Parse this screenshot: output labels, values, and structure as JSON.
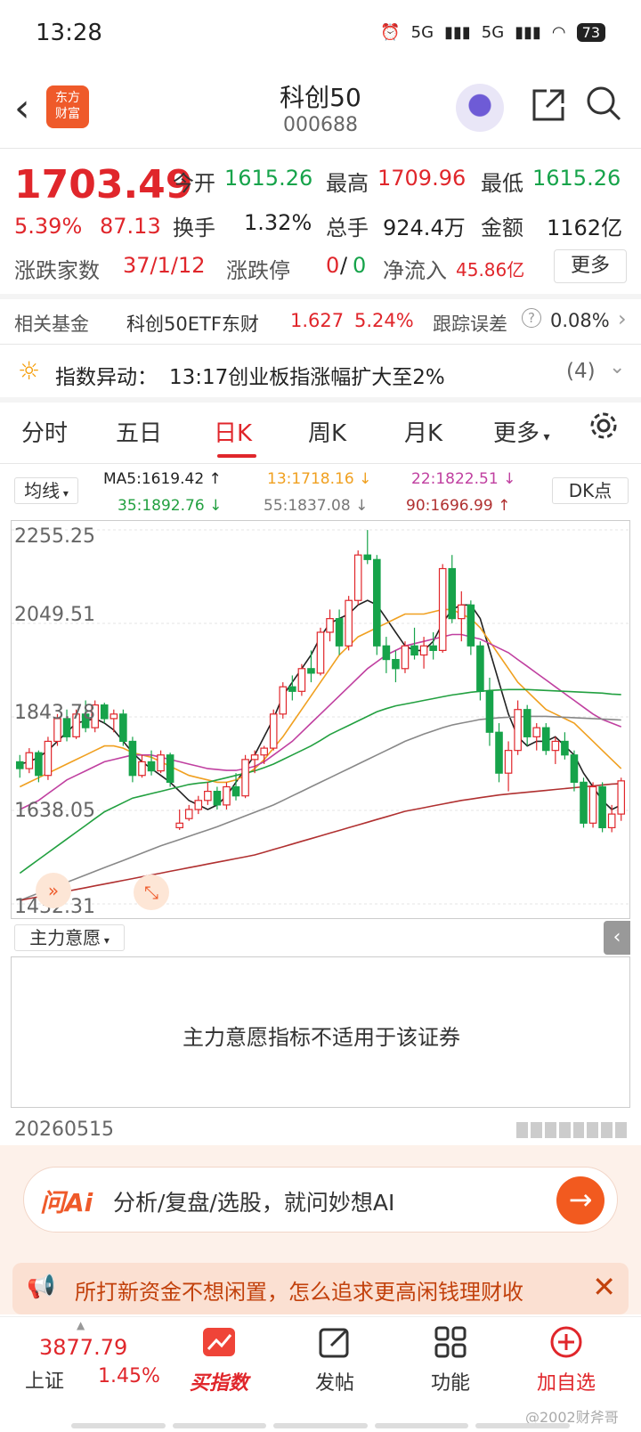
{
  "status": {
    "time": "13:28",
    "net1": "5G",
    "net2": "5G",
    "battery": "73"
  },
  "header": {
    "title": "科创50",
    "code": "000688",
    "logo_l1": "东方",
    "logo_l2": "财富"
  },
  "quote": {
    "price": "1703.49",
    "pct": "5.39%",
    "change": "87.13",
    "open_label": "今开",
    "open": "1615.26",
    "high_label": "最高",
    "high": "1709.96",
    "low_label": "最低",
    "low": "1615.26",
    "turnover_label": "换手",
    "turnover": "1.32%",
    "volume_label": "总手",
    "volume": "924.4万",
    "amount_label": "金额",
    "amount": "1162亿",
    "breadth_label": "涨跌家数",
    "breadth": "37/1/12",
    "limit_label": "涨跌停",
    "limit_up": "0",
    "limit_sep": "/",
    "limit_down": "0",
    "netflow_label": "净流入",
    "netflow": "45.86亿",
    "more": "更多"
  },
  "fund": {
    "label": "相关基金",
    "name": "科创50ETF东财",
    "price": "1.627",
    "pct": "5.24%",
    "track_label": "跟踪误差",
    "track": "0.08%"
  },
  "alert": {
    "label": "指数异动：",
    "text": "13:17创业板指涨幅扩大至2%",
    "count": "(4)"
  },
  "tabs": [
    "分时",
    "五日",
    "日K",
    "周K",
    "月K",
    "更多"
  ],
  "ma": {
    "button": "均线",
    "ma5": "MA5:1619.42 ↑",
    "ma13": "13:1718.16 ↓",
    "ma22": "22:1822.51 ↓",
    "ma35": "35:1892.76 ↓",
    "ma55": "55:1837.08 ↓",
    "ma90": "90:1696.99 ↑",
    "dk": "DK点"
  },
  "colors": {
    "up": "#e0262b",
    "down": "#16a34a",
    "accent": "#ef5a2a"
  },
  "chart_data": {
    "type": "candlestick",
    "y_ticks": [
      "2255.25",
      "2049.51",
      "1843.78",
      "1638.05",
      "1432.31"
    ],
    "ylim": [
      1432.31,
      2255.25
    ],
    "candles": [
      [
        1745,
        1760,
        1710,
        1730
      ],
      [
        1730,
        1775,
        1720,
        1765
      ],
      [
        1765,
        1770,
        1700,
        1715
      ],
      [
        1715,
        1800,
        1705,
        1790
      ],
      [
        1790,
        1850,
        1780,
        1840
      ],
      [
        1840,
        1860,
        1790,
        1800
      ],
      [
        1800,
        1860,
        1795,
        1850
      ],
      [
        1850,
        1880,
        1810,
        1820
      ],
      [
        1820,
        1880,
        1810,
        1870
      ],
      [
        1870,
        1875,
        1830,
        1840
      ],
      [
        1840,
        1860,
        1810,
        1850
      ],
      [
        1850,
        1860,
        1780,
        1790
      ],
      [
        1790,
        1800,
        1700,
        1715
      ],
      [
        1715,
        1760,
        1710,
        1745
      ],
      [
        1745,
        1770,
        1715,
        1725
      ],
      [
        1725,
        1770,
        1720,
        1760
      ],
      [
        1760,
        1765,
        1690,
        1700
      ],
      [
        1600,
        1640,
        1595,
        1610
      ],
      [
        1620,
        1650,
        1615,
        1640
      ],
      [
        1640,
        1670,
        1630,
        1660
      ],
      [
        1660,
        1700,
        1650,
        1680
      ],
      [
        1680,
        1690,
        1640,
        1650
      ],
      [
        1650,
        1700,
        1640,
        1690
      ],
      [
        1690,
        1720,
        1660,
        1670
      ],
      [
        1670,
        1760,
        1665,
        1750
      ],
      [
        1750,
        1770,
        1720,
        1760
      ],
      [
        1760,
        1780,
        1740,
        1775
      ],
      [
        1775,
        1860,
        1770,
        1850
      ],
      [
        1850,
        1920,
        1840,
        1910
      ],
      [
        1910,
        1935,
        1880,
        1900
      ],
      [
        1900,
        1960,
        1890,
        1950
      ],
      [
        1950,
        1990,
        1920,
        1940
      ],
      [
        1940,
        2040,
        1935,
        2030
      ],
      [
        2030,
        2080,
        2010,
        2060
      ],
      [
        2060,
        2080,
        1980,
        2000
      ],
      [
        2000,
        2110,
        1990,
        2100
      ],
      [
        2100,
        2210,
        2090,
        2200
      ],
      [
        2200,
        2255,
        2180,
        2190
      ],
      [
        2190,
        2200,
        1980,
        2000
      ],
      [
        2000,
        2020,
        1940,
        1970
      ],
      [
        1970,
        1990,
        1920,
        1950
      ],
      [
        1950,
        2010,
        1940,
        2000
      ],
      [
        2000,
        2040,
        1970,
        1980
      ],
      [
        1980,
        2020,
        1950,
        2000
      ],
      [
        2000,
        2030,
        1970,
        1990
      ],
      [
        1990,
        2180,
        1985,
        2170
      ],
      [
        2170,
        2200,
        2050,
        2060
      ],
      [
        2060,
        2120,
        2010,
        2090
      ],
      [
        2090,
        2100,
        1980,
        2000
      ],
      [
        2000,
        2010,
        1880,
        1900
      ],
      [
        1900,
        1930,
        1780,
        1810
      ],
      [
        1810,
        1830,
        1700,
        1720
      ],
      [
        1720,
        1790,
        1680,
        1770
      ],
      [
        1770,
        1880,
        1760,
        1860
      ],
      [
        1860,
        1870,
        1780,
        1800
      ],
      [
        1800,
        1830,
        1770,
        1820
      ],
      [
        1820,
        1830,
        1760,
        1770
      ],
      [
        1770,
        1800,
        1740,
        1790
      ],
      [
        1790,
        1810,
        1750,
        1760
      ],
      [
        1760,
        1770,
        1680,
        1700
      ],
      [
        1700,
        1710,
        1600,
        1610
      ],
      [
        1610,
        1700,
        1600,
        1690
      ],
      [
        1690,
        1700,
        1590,
        1600
      ],
      [
        1600,
        1650,
        1590,
        1630
      ],
      [
        1630,
        1710,
        1615,
        1703
      ]
    ],
    "ma_lines": [
      {
        "name": "MA5",
        "color": "#222222",
        "values": [
          1740,
          1745,
          1755,
          1770,
          1790,
          1810,
          1830,
          1835,
          1840,
          1830,
          1815,
          1790,
          1765,
          1745,
          1730,
          1715,
          1700,
          1680,
          1660,
          1650,
          1640,
          1650,
          1670,
          1700,
          1730,
          1760,
          1800,
          1840,
          1890,
          1920,
          1950,
          1980,
          2020,
          2050,
          2060,
          2070,
          2090,
          2100,
          2090,
          2060,
          2030,
          2000,
          1990,
          1990,
          2010,
          2050,
          2080,
          2090,
          2090,
          2060,
          1990,
          1920,
          1850,
          1800,
          1780,
          1790,
          1790,
          1800,
          1780,
          1760,
          1720,
          1690,
          1660,
          1640,
          1650
        ]
      },
      {
        "name": "13",
        "color": "#f0a020",
        "values": [
          1690,
          1700,
          1710,
          1720,
          1730,
          1740,
          1750,
          1760,
          1770,
          1780,
          1780,
          1775,
          1765,
          1760,
          1755,
          1745,
          1735,
          1725,
          1715,
          1710,
          1705,
          1700,
          1700,
          1705,
          1715,
          1730,
          1750,
          1775,
          1800,
          1830,
          1860,
          1890,
          1920,
          1950,
          1980,
          2000,
          2020,
          2030,
          2040,
          2050,
          2060,
          2070,
          2070,
          2070,
          2075,
          2080,
          2080,
          2070,
          2060,
          2040,
          2010,
          1980,
          1950,
          1920,
          1900,
          1880,
          1860,
          1850,
          1840,
          1830,
          1810,
          1790,
          1770,
          1750,
          1730
        ]
      },
      {
        "name": "22",
        "color": "#c040a0",
        "values": [
          1640,
          1650,
          1660,
          1675,
          1690,
          1705,
          1715,
          1725,
          1735,
          1745,
          1750,
          1755,
          1760,
          1760,
          1760,
          1755,
          1750,
          1745,
          1740,
          1735,
          1730,
          1728,
          1726,
          1726,
          1730,
          1735,
          1745,
          1760,
          1775,
          1790,
          1810,
          1830,
          1850,
          1870,
          1890,
          1910,
          1930,
          1950,
          1965,
          1980,
          1990,
          2000,
          2005,
          2010,
          2015,
          2020,
          2025,
          2025,
          2020,
          2015,
          2005,
          1995,
          1985,
          1970,
          1955,
          1940,
          1925,
          1910,
          1895,
          1880,
          1865,
          1850,
          1838,
          1830,
          1822
        ]
      },
      {
        "name": "35",
        "color": "#22a040",
        "values": [
          1500,
          1515,
          1530,
          1545,
          1560,
          1575,
          1590,
          1605,
          1620,
          1635,
          1645,
          1655,
          1665,
          1670,
          1675,
          1680,
          1685,
          1690,
          1695,
          1698,
          1700,
          1705,
          1710,
          1715,
          1720,
          1725,
          1732,
          1740,
          1750,
          1760,
          1770,
          1780,
          1792,
          1805,
          1815,
          1825,
          1835,
          1845,
          1855,
          1862,
          1868,
          1872,
          1876,
          1880,
          1884,
          1888,
          1892,
          1895,
          1898,
          1900,
          1902,
          1903,
          1904,
          1904,
          1904,
          1903,
          1902,
          1901,
          1900,
          1899,
          1898,
          1897,
          1896,
          1894,
          1893
        ]
      },
      {
        "name": "55",
        "color": "#888888",
        "values": [
          1440,
          1448,
          1456,
          1464,
          1472,
          1480,
          1488,
          1496,
          1504,
          1512,
          1520,
          1528,
          1536,
          1544,
          1552,
          1560,
          1567,
          1574,
          1581,
          1588,
          1595,
          1602,
          1610,
          1618,
          1626,
          1634,
          1642,
          1650,
          1660,
          1670,
          1680,
          1690,
          1700,
          1710,
          1720,
          1730,
          1740,
          1750,
          1760,
          1770,
          1780,
          1790,
          1798,
          1806,
          1813,
          1820,
          1826,
          1830,
          1834,
          1838,
          1840,
          1842,
          1843,
          1844,
          1845,
          1845,
          1845,
          1844,
          1843,
          1842,
          1841,
          1840,
          1839,
          1838,
          1837
        ]
      },
      {
        "name": "90",
        "color": "#b03030",
        "values": [
          1440,
          1444,
          1448,
          1452,
          1456,
          1460,
          1464,
          1468,
          1472,
          1476,
          1480,
          1484,
          1488,
          1492,
          1496,
          1500,
          1504,
          1508,
          1512,
          1516,
          1520,
          1524,
          1528,
          1532,
          1536,
          1540,
          1546,
          1552,
          1558,
          1564,
          1570,
          1576,
          1582,
          1588,
          1594,
          1600,
          1606,
          1612,
          1618,
          1624,
          1630,
          1636,
          1640,
          1644,
          1648,
          1652,
          1656,
          1660,
          1663,
          1666,
          1669,
          1672,
          1674,
          1676,
          1678,
          1680,
          1682,
          1684,
          1686,
          1688,
          1690,
          1692,
          1694,
          1696,
          1697
        ]
      }
    ]
  },
  "zhuli": {
    "button": "主力意愿",
    "message": "主力意愿指标不适用于该证券"
  },
  "date": "20260515",
  "ai": {
    "logo": "问Ai",
    "placeholder": "分析/复盘/选股，就问妙想AI"
  },
  "notice": {
    "text": "所打新资金不想闲置，怎么追求更高闲钱理财收"
  },
  "bottom": {
    "index_value": "3877.79",
    "index_name": "上证",
    "index_pct": "1.45%",
    "nav": [
      "买指数",
      "发帖",
      "功能",
      "加自选"
    ]
  },
  "watermark": "@2002财斧哥"
}
